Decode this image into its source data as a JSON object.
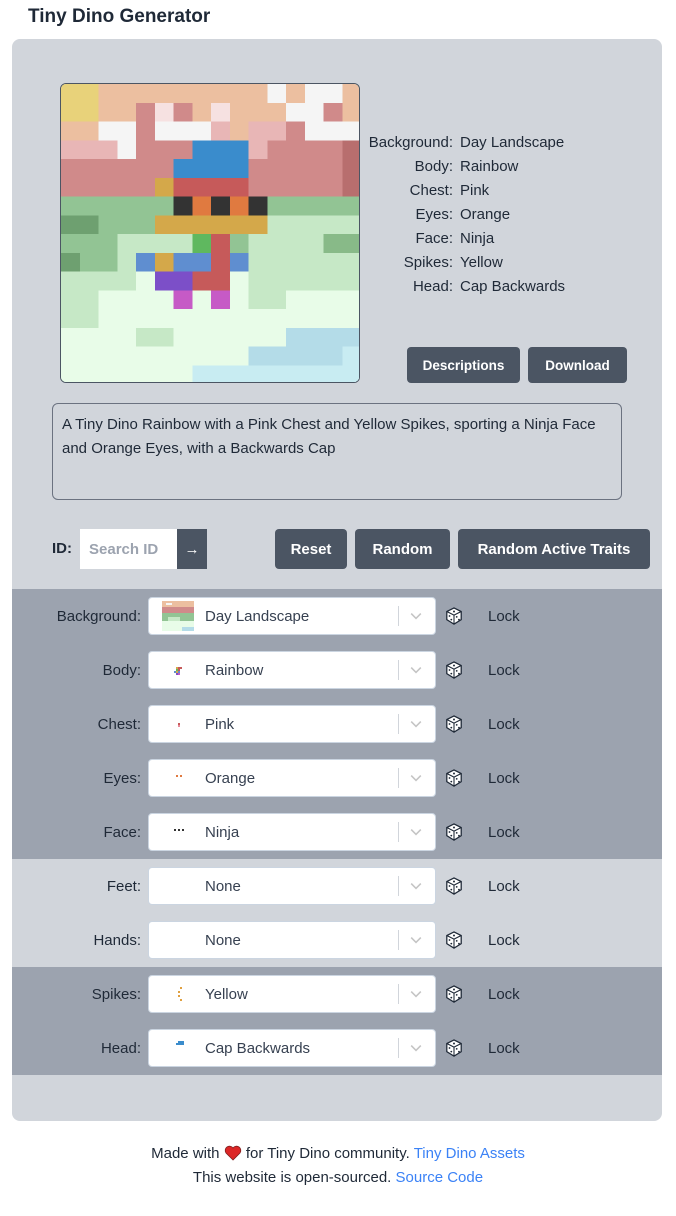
{
  "app_title": "Tiny Dino Generator",
  "colors": {
    "card_bg": "#d1d5db",
    "active_row_bg": "#9ca3af",
    "button_bg": "#4b5563",
    "link": "#3b82f6",
    "heart": "#dc2626"
  },
  "summary": [
    {
      "key": "Background:",
      "value": "Day Landscape"
    },
    {
      "key": "Body:",
      "value": "Rainbow"
    },
    {
      "key": "Chest:",
      "value": "Pink"
    },
    {
      "key": "Eyes:",
      "value": "Orange"
    },
    {
      "key": "Face:",
      "value": "Ninja"
    },
    {
      "key": "Spikes:",
      "value": "Yellow"
    },
    {
      "key": "Head:",
      "value": "Cap Backwards"
    }
  ],
  "buttons": {
    "descriptions": "Descriptions",
    "download": "Download",
    "reset": "Reset",
    "random": "Random",
    "random_active": "Random Active Traits"
  },
  "description": "A Tiny Dino Rainbow with a Pink Chest and Yellow Spikes, sporting a Ninja Face and Orange Eyes, with a Backwards Cap",
  "search": {
    "label": "ID:",
    "placeholder": "Search ID",
    "go_icon": "→"
  },
  "traits": [
    {
      "label": "Background:",
      "value": "Day Landscape",
      "lock": "Lock",
      "active": true,
      "thumb_icon": "landscape-thumb-icon"
    },
    {
      "label": "Body:",
      "value": "Rainbow",
      "lock": "Lock",
      "active": true,
      "thumb_icon": "rainbow-body-thumb-icon"
    },
    {
      "label": "Chest:",
      "value": "Pink",
      "lock": "Lock",
      "active": true,
      "thumb_icon": "pink-chest-thumb-icon"
    },
    {
      "label": "Eyes:",
      "value": "Orange",
      "lock": "Lock",
      "active": true,
      "thumb_icon": "orange-eyes-thumb-icon"
    },
    {
      "label": "Face:",
      "value": "Ninja",
      "lock": "Lock",
      "active": true,
      "thumb_icon": "ninja-face-thumb-icon"
    },
    {
      "label": "Feet:",
      "value": "None",
      "lock": "Lock",
      "active": false,
      "thumb_icon": ""
    },
    {
      "label": "Hands:",
      "value": "None",
      "lock": "Lock",
      "active": false,
      "thumb_icon": ""
    },
    {
      "label": "Spikes:",
      "value": "Yellow",
      "lock": "Lock",
      "active": true,
      "thumb_icon": "yellow-spikes-thumb-icon"
    },
    {
      "label": "Head:",
      "value": "Cap Backwards",
      "lock": "Lock",
      "active": true,
      "thumb_icon": "cap-backwards-thumb-icon"
    }
  ],
  "footer": {
    "made_with": "Made with",
    "for_text": "for Tiny Dino community.",
    "assets_link": "Tiny Dino Assets",
    "open_source": "This website is open-sourced.",
    "source_link": "Source Code"
  }
}
